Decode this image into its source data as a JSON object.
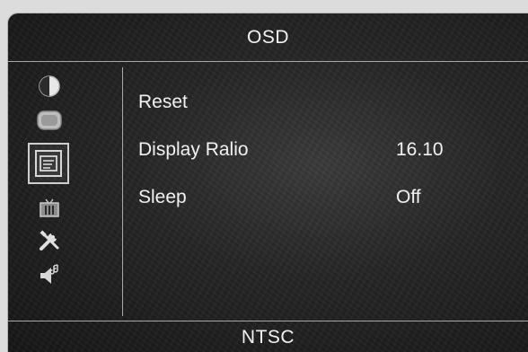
{
  "header": {
    "title": "OSD"
  },
  "sidebar": {
    "icons": [
      {
        "name": "contrast-icon"
      },
      {
        "name": "color-icon"
      },
      {
        "name": "display-icon",
        "selected": true
      },
      {
        "name": "input-source-icon"
      },
      {
        "name": "tools-icon"
      },
      {
        "name": "audio-icon"
      }
    ]
  },
  "menu": {
    "items": [
      {
        "label": "Reset",
        "value": ""
      },
      {
        "label": "Display Ralio",
        "value": "16.10"
      },
      {
        "label": "Sleep",
        "value": "Off"
      }
    ]
  },
  "footer": {
    "status": "NTSC"
  },
  "colors": {
    "text": "#f2f2f2",
    "divider": "#a8a8a8",
    "background": "#262626"
  }
}
